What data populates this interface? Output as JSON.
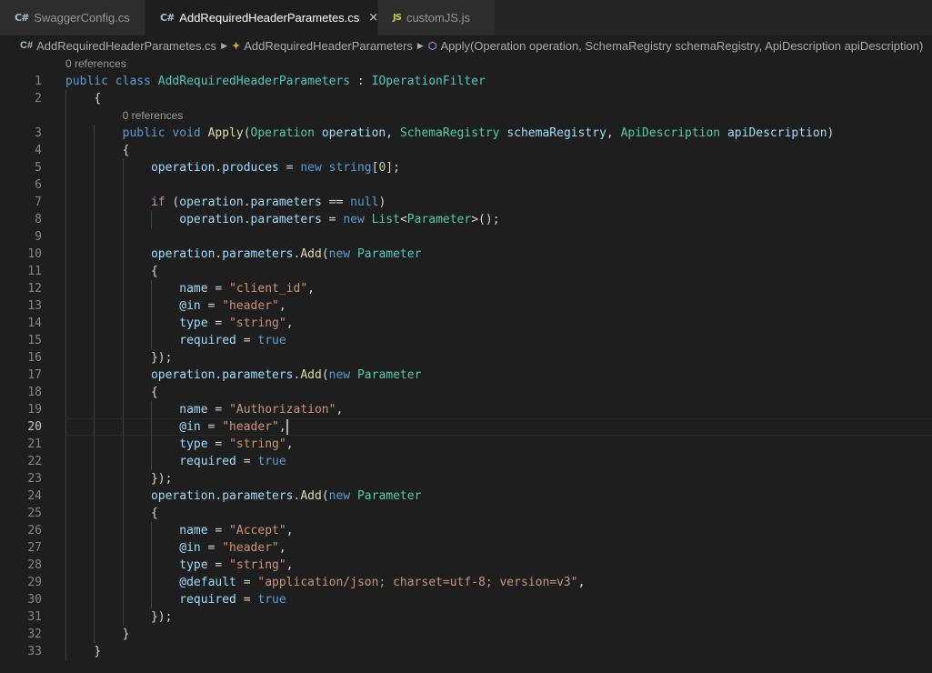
{
  "tabs": [
    {
      "icon": "C#",
      "label": "SwaggerConfig.cs",
      "active": false,
      "close": ""
    },
    {
      "icon": "C#",
      "label": "AddRequiredHeaderParametes.cs",
      "active": true,
      "close": "×"
    },
    {
      "icon": "JS",
      "label": "customJS.js",
      "active": false,
      "close": ""
    }
  ],
  "breadcrumb": {
    "file": "AddRequiredHeaderParametes.cs",
    "class": "AddRequiredHeaderParameters",
    "method": "Apply(Operation operation, SchemaRegistry schemaRegistry, ApiDescription apiDescription)"
  },
  "editor": {
    "current_line": 20,
    "codelens": [
      {
        "before_line": 1,
        "text": "0 references"
      },
      {
        "before_line": 3,
        "text": "0 references"
      }
    ],
    "lines": [
      {
        "n": "1",
        "indent": 0,
        "tokens": [
          [
            "kw",
            "public"
          ],
          [
            "pl",
            " "
          ],
          [
            "kw",
            "class"
          ],
          [
            "pl",
            " "
          ],
          [
            "ty",
            "AddRequiredHeaderParameters"
          ],
          [
            "pl",
            " : "
          ],
          [
            "ty",
            "IOperationFilter"
          ]
        ]
      },
      {
        "n": "2",
        "indent": 4,
        "tokens": [
          [
            "pl",
            "{"
          ]
        ]
      },
      {
        "n": "3",
        "indent": 8,
        "tokens": [
          [
            "kw",
            "public"
          ],
          [
            "pl",
            " "
          ],
          [
            "kw",
            "void"
          ],
          [
            "pl",
            " "
          ],
          [
            "fn",
            "Apply"
          ],
          [
            "pl",
            "("
          ],
          [
            "ty",
            "Operation"
          ],
          [
            "pl",
            " "
          ],
          [
            "vr",
            "operation"
          ],
          [
            "pl",
            ", "
          ],
          [
            "ty",
            "SchemaRegistry"
          ],
          [
            "pl",
            " "
          ],
          [
            "vr",
            "schemaRegistry"
          ],
          [
            "pl",
            ", "
          ],
          [
            "ty",
            "ApiDescription"
          ],
          [
            "pl",
            " "
          ],
          [
            "vr",
            "apiDescription"
          ],
          [
            "pl",
            ")"
          ]
        ]
      },
      {
        "n": "4",
        "indent": 8,
        "tokens": [
          [
            "pl",
            "{"
          ]
        ]
      },
      {
        "n": "5",
        "indent": 12,
        "tokens": [
          [
            "vr",
            "operation"
          ],
          [
            "pl",
            "."
          ],
          [
            "vr",
            "produces"
          ],
          [
            "pl",
            " = "
          ],
          [
            "kw",
            "new"
          ],
          [
            "pl",
            " "
          ],
          [
            "kw",
            "string"
          ],
          [
            "pl",
            "["
          ],
          [
            "num",
            "0"
          ],
          [
            "pl",
            "];"
          ]
        ]
      },
      {
        "n": "6",
        "indent": 0,
        "tokens": []
      },
      {
        "n": "7",
        "indent": 12,
        "tokens": [
          [
            "ctl",
            "if"
          ],
          [
            "pl",
            " ("
          ],
          [
            "vr",
            "operation"
          ],
          [
            "pl",
            "."
          ],
          [
            "vr",
            "parameters"
          ],
          [
            "pl",
            " == "
          ],
          [
            "kw",
            "null"
          ],
          [
            "pl",
            ")"
          ]
        ]
      },
      {
        "n": "8",
        "indent": 16,
        "tokens": [
          [
            "vr",
            "operation"
          ],
          [
            "pl",
            "."
          ],
          [
            "vr",
            "parameters"
          ],
          [
            "pl",
            " = "
          ],
          [
            "kw",
            "new"
          ],
          [
            "pl",
            " "
          ],
          [
            "ty",
            "List"
          ],
          [
            "pl",
            "<"
          ],
          [
            "ty",
            "Parameter"
          ],
          [
            "pl",
            ">();"
          ]
        ]
      },
      {
        "n": "9",
        "indent": 0,
        "tokens": []
      },
      {
        "n": "10",
        "indent": 12,
        "tokens": [
          [
            "vr",
            "operation"
          ],
          [
            "pl",
            "."
          ],
          [
            "vr",
            "parameters"
          ],
          [
            "pl",
            "."
          ],
          [
            "fn",
            "Add"
          ],
          [
            "pl",
            "("
          ],
          [
            "kw",
            "new"
          ],
          [
            "pl",
            " "
          ],
          [
            "ty",
            "Parameter"
          ]
        ]
      },
      {
        "n": "11",
        "indent": 12,
        "tokens": [
          [
            "pl",
            "{"
          ]
        ]
      },
      {
        "n": "12",
        "indent": 16,
        "tokens": [
          [
            "vr",
            "name"
          ],
          [
            "pl",
            " = "
          ],
          [
            "str",
            "\"client_id\""
          ],
          [
            "pl",
            ","
          ]
        ]
      },
      {
        "n": "13",
        "indent": 16,
        "tokens": [
          [
            "vr",
            "@in"
          ],
          [
            "pl",
            " = "
          ],
          [
            "str",
            "\"header\""
          ],
          [
            "pl",
            ","
          ]
        ]
      },
      {
        "n": "14",
        "indent": 16,
        "tokens": [
          [
            "vr",
            "type"
          ],
          [
            "pl",
            " = "
          ],
          [
            "str",
            "\"string\""
          ],
          [
            "pl",
            ","
          ]
        ]
      },
      {
        "n": "15",
        "indent": 16,
        "tokens": [
          [
            "vr",
            "required"
          ],
          [
            "pl",
            " = "
          ],
          [
            "kw",
            "true"
          ]
        ]
      },
      {
        "n": "16",
        "indent": 12,
        "tokens": [
          [
            "pl",
            "});"
          ]
        ]
      },
      {
        "n": "17",
        "indent": 12,
        "tokens": [
          [
            "vr",
            "operation"
          ],
          [
            "pl",
            "."
          ],
          [
            "vr",
            "parameters"
          ],
          [
            "pl",
            "."
          ],
          [
            "fn",
            "Add"
          ],
          [
            "pl",
            "("
          ],
          [
            "kw",
            "new"
          ],
          [
            "pl",
            " "
          ],
          [
            "ty",
            "Parameter"
          ]
        ]
      },
      {
        "n": "18",
        "indent": 12,
        "tokens": [
          [
            "pl",
            "{"
          ]
        ]
      },
      {
        "n": "19",
        "indent": 16,
        "tokens": [
          [
            "vr",
            "name"
          ],
          [
            "pl",
            " = "
          ],
          [
            "str",
            "\"Authorization\""
          ],
          [
            "pl",
            ","
          ]
        ]
      },
      {
        "n": "20",
        "indent": 16,
        "tokens": [
          [
            "vr",
            "@in"
          ],
          [
            "pl",
            " = "
          ],
          [
            "str",
            "\"header\""
          ],
          [
            "pl",
            ","
          ]
        ]
      },
      {
        "n": "21",
        "indent": 16,
        "tokens": [
          [
            "vr",
            "type"
          ],
          [
            "pl",
            " = "
          ],
          [
            "str",
            "\"string\""
          ],
          [
            "pl",
            ","
          ]
        ]
      },
      {
        "n": "22",
        "indent": 16,
        "tokens": [
          [
            "vr",
            "required"
          ],
          [
            "pl",
            " = "
          ],
          [
            "kw",
            "true"
          ]
        ]
      },
      {
        "n": "23",
        "indent": 12,
        "tokens": [
          [
            "pl",
            "});"
          ]
        ]
      },
      {
        "n": "24",
        "indent": 12,
        "tokens": [
          [
            "vr",
            "operation"
          ],
          [
            "pl",
            "."
          ],
          [
            "vr",
            "parameters"
          ],
          [
            "pl",
            "."
          ],
          [
            "fn",
            "Add"
          ],
          [
            "pl",
            "("
          ],
          [
            "kw",
            "new"
          ],
          [
            "pl",
            " "
          ],
          [
            "ty",
            "Parameter"
          ]
        ]
      },
      {
        "n": "25",
        "indent": 12,
        "tokens": [
          [
            "pl",
            "{"
          ]
        ]
      },
      {
        "n": "26",
        "indent": 16,
        "tokens": [
          [
            "vr",
            "name"
          ],
          [
            "pl",
            " = "
          ],
          [
            "str",
            "\"Accept\""
          ],
          [
            "pl",
            ","
          ]
        ]
      },
      {
        "n": "27",
        "indent": 16,
        "tokens": [
          [
            "vr",
            "@in"
          ],
          [
            "pl",
            " = "
          ],
          [
            "str",
            "\"header\""
          ],
          [
            "pl",
            ","
          ]
        ]
      },
      {
        "n": "28",
        "indent": 16,
        "tokens": [
          [
            "vr",
            "type"
          ],
          [
            "pl",
            " = "
          ],
          [
            "str",
            "\"string\""
          ],
          [
            "pl",
            ","
          ]
        ]
      },
      {
        "n": "29",
        "indent": 16,
        "tokens": [
          [
            "vr",
            "@default"
          ],
          [
            "pl",
            " = "
          ],
          [
            "str",
            "\"application/json; charset=utf-8; version=v3\""
          ],
          [
            "pl",
            ","
          ]
        ]
      },
      {
        "n": "30",
        "indent": 16,
        "tokens": [
          [
            "vr",
            "required"
          ],
          [
            "pl",
            " = "
          ],
          [
            "kw",
            "true"
          ]
        ]
      },
      {
        "n": "31",
        "indent": 12,
        "tokens": [
          [
            "pl",
            "});"
          ]
        ]
      },
      {
        "n": "32",
        "indent": 8,
        "tokens": [
          [
            "pl",
            "}"
          ]
        ]
      },
      {
        "n": "33",
        "indent": 4,
        "tokens": [
          [
            "pl",
            "}"
          ]
        ]
      }
    ]
  },
  "colors": {
    "background": "#1e1e1e",
    "tabbar": "#252526",
    "keyword": "#569cd6",
    "type": "#4ec9b0",
    "function": "#dcdcaa",
    "string": "#ce9178",
    "variable": "#9cdcfe"
  }
}
